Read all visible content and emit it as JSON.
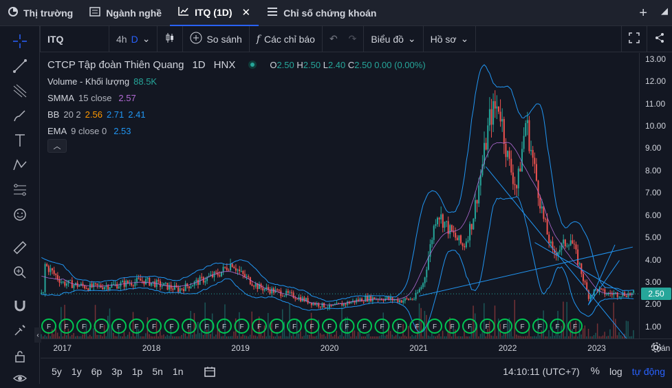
{
  "tabs": [
    {
      "label": "Thị trường",
      "icon": "pie-chart-icon"
    },
    {
      "label": "Ngành nghề",
      "icon": "list-icon"
    },
    {
      "label": "ITQ (1D)",
      "icon": "chart-line-icon",
      "active": true
    },
    {
      "label": "Chỉ số chứng khoán",
      "icon": "menu-icon"
    }
  ],
  "toolbar": {
    "symbol": "ITQ",
    "interval_alt": "4h",
    "interval": "D",
    "compare": "So sánh",
    "indicators": "Các chỉ báo",
    "chart_type": "Biểu đồ",
    "profile": "Hồ sơ"
  },
  "legend": {
    "title": "CTCP Tập đoàn Thiên Quang",
    "timeframe": "1D",
    "exchange": "HNX",
    "o_label": "O",
    "o_val": "2.50",
    "h_label": "H",
    "h_val": "2.50",
    "l_label": "L",
    "l_val": "2.40",
    "c_label": "C",
    "c_val": "2.50",
    "change": "0.00 (0.00%)",
    "volume_label": "Volume - Khối lượng",
    "volume_val": "88.5K",
    "smma_label": "SMMA",
    "smma_params": "15 close",
    "smma_val": "2.57",
    "bb_label": "BB",
    "bb_params": "20 2",
    "bb_basis": "2.56",
    "bb_upper": "2.71",
    "bb_lower": "2.41",
    "ema_label": "EMA",
    "ema_params": "9 close 0",
    "ema_val": "2.53"
  },
  "price_axis": [
    "13.00",
    "12.00",
    "11.00",
    "10.00",
    "9.00",
    "8.00",
    "7.00",
    "6.00",
    "5.00",
    "4.00",
    "3.00",
    "2.00",
    "1.00"
  ],
  "current_price": "2.50",
  "time_axis": [
    "2017",
    "2018",
    "2019",
    "2020",
    "2021",
    "2022",
    "2023",
    "Thán"
  ],
  "ranges": [
    "5y",
    "1y",
    "6p",
    "3p",
    "1p",
    "5n",
    "1n"
  ],
  "footer": {
    "time": "14:10:11 (UTC+7)",
    "percent": "%",
    "log": "log",
    "auto": "tự động"
  },
  "chart_data": {
    "type": "candlestick",
    "x": [
      "2017",
      "2018",
      "2019",
      "2020",
      "2021",
      "2022",
      "2023"
    ],
    "ylim": [
      0.5,
      13.3
    ],
    "price_path": [
      {
        "t": 2016.8,
        "v": 3.8
      },
      {
        "t": 2017.0,
        "v": 3.0
      },
      {
        "t": 2017.3,
        "v": 2.8
      },
      {
        "t": 2017.6,
        "v": 2.9
      },
      {
        "t": 2017.9,
        "v": 3.1
      },
      {
        "t": 2018.1,
        "v": 2.9
      },
      {
        "t": 2018.3,
        "v": 2.7
      },
      {
        "t": 2018.55,
        "v": 3.1
      },
      {
        "t": 2018.75,
        "v": 3.4
      },
      {
        "t": 2018.9,
        "v": 3.9
      },
      {
        "t": 2019.0,
        "v": 3.4
      },
      {
        "t": 2019.2,
        "v": 2.8
      },
      {
        "t": 2019.4,
        "v": 2.6
      },
      {
        "t": 2019.6,
        "v": 2.4
      },
      {
        "t": 2019.8,
        "v": 2.1
      },
      {
        "t": 2020.0,
        "v": 1.9
      },
      {
        "t": 2020.2,
        "v": 2.1
      },
      {
        "t": 2020.4,
        "v": 2.3
      },
      {
        "t": 2020.6,
        "v": 2.3
      },
      {
        "t": 2020.8,
        "v": 2.2
      },
      {
        "t": 2020.95,
        "v": 2.3
      },
      {
        "t": 2021.05,
        "v": 3.0
      },
      {
        "t": 2021.2,
        "v": 6.2
      },
      {
        "t": 2021.35,
        "v": 5.3
      },
      {
        "t": 2021.5,
        "v": 4.6
      },
      {
        "t": 2021.6,
        "v": 5.8
      },
      {
        "t": 2021.7,
        "v": 8.0
      },
      {
        "t": 2021.8,
        "v": 10.5
      },
      {
        "t": 2021.9,
        "v": 11.0
      },
      {
        "t": 2022.0,
        "v": 8.5
      },
      {
        "t": 2022.1,
        "v": 7.2
      },
      {
        "t": 2022.2,
        "v": 10.3
      },
      {
        "t": 2022.3,
        "v": 8.0
      },
      {
        "t": 2022.4,
        "v": 5.8
      },
      {
        "t": 2022.5,
        "v": 4.3
      },
      {
        "t": 2022.6,
        "v": 4.6
      },
      {
        "t": 2022.7,
        "v": 5.0
      },
      {
        "t": 2022.8,
        "v": 3.8
      },
      {
        "t": 2022.9,
        "v": 2.4
      },
      {
        "t": 2023.0,
        "v": 2.7
      },
      {
        "t": 2023.1,
        "v": 2.5
      }
    ],
    "event_markers": 31,
    "marker_label": "F"
  },
  "colors": {
    "bg": "#131722",
    "up": "#26a69a",
    "down": "#ef5350",
    "bb": "#2196f3",
    "accent": "#2962ff"
  }
}
